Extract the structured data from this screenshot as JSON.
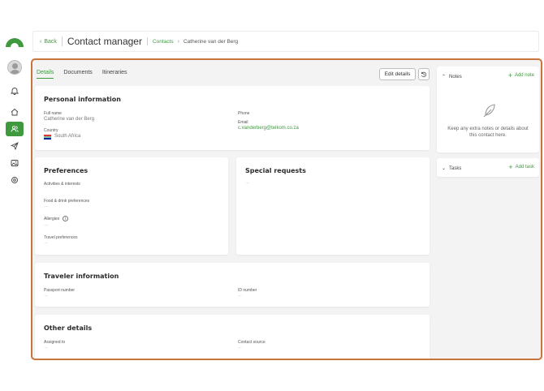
{
  "sidebar": {
    "icons": [
      "logo-icon",
      "avatar",
      "bell-icon",
      "home-icon",
      "users-icon",
      "send-icon",
      "image-icon",
      "settings-icon"
    ],
    "accent": "#3f9a3f"
  },
  "topbar": {
    "back_label": "Back",
    "title": "Contact manager",
    "crumb_link": "Contacts",
    "crumb_current": "Catherine van der Berg"
  },
  "tabs": [
    {
      "label": "Details",
      "active": true
    },
    {
      "label": "Documents",
      "active": false
    },
    {
      "label": "Itineraries",
      "active": false
    }
  ],
  "edit_label": "Edit details",
  "personal": {
    "title": "Personal information",
    "full_name_label": "Full name",
    "full_name": "Catherine van der Berg",
    "country_label": "Country",
    "country": "South Africa",
    "phone_label": "Phone",
    "phone": "",
    "email_label": "Email",
    "email": "c.vanderberg@telkom.co.za"
  },
  "preferences": {
    "title": "Preferences",
    "activities_label": "Activities & interests",
    "food_label": "Food & drink preferences",
    "food_value": "...",
    "allergies_label": "Allergies",
    "allergies_value": "...",
    "travel_label": "Travel preferences",
    "travel_value": "..."
  },
  "special": {
    "title": "Special requests",
    "value": "..."
  },
  "traveler": {
    "title": "Traveler information",
    "passport_label": "Passport number",
    "passport_value": "...",
    "id_label": "ID number",
    "id_value": "..."
  },
  "other": {
    "title": "Other details",
    "assigned_label": "Assigned to",
    "assigned_value": "...",
    "source_label": "Contact source",
    "source_value": "..."
  },
  "notes": {
    "title": "Notes",
    "add_label": "Add note",
    "empty_text": "Keep any extra notes or details about this contact here."
  },
  "tasks": {
    "title": "Tasks",
    "add_label": "Add task"
  },
  "colors": {
    "highlight_border": "#c8743a",
    "green": "#3f9a3f"
  }
}
